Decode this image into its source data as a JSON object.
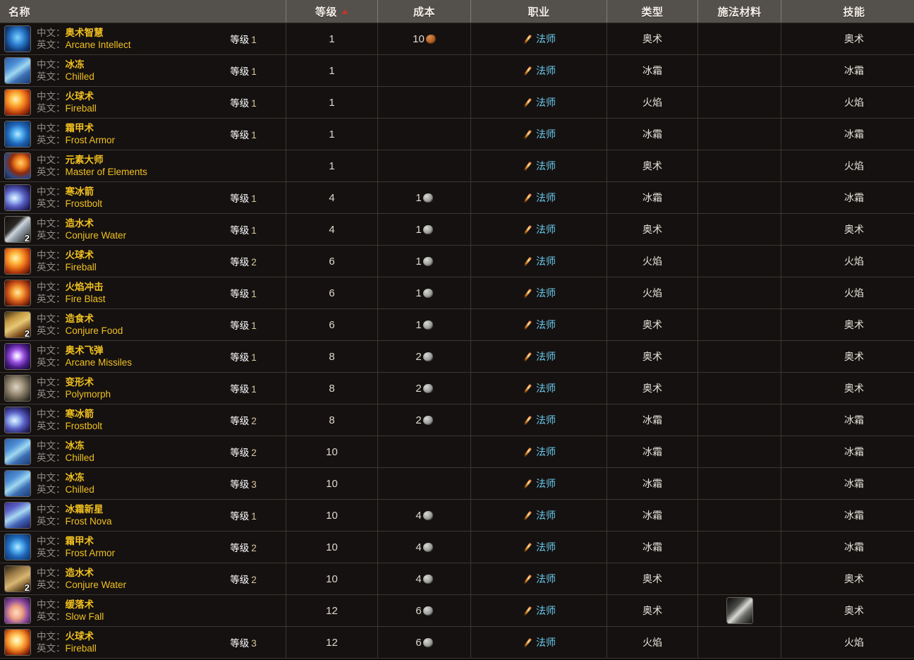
{
  "table": {
    "columns": [
      {
        "key": "name",
        "label": "名称",
        "sorted": false
      },
      {
        "key": "level",
        "label": "等级",
        "sorted": true,
        "sort_dir": "asc"
      },
      {
        "key": "cost",
        "label": "成本",
        "sorted": false
      },
      {
        "key": "class",
        "label": "职业",
        "sorted": false
      },
      {
        "key": "type",
        "label": "类型",
        "sorted": false
      },
      {
        "key": "reagent",
        "label": "施法材料",
        "sorted": false
      },
      {
        "key": "skill",
        "label": "技能",
        "sorted": false
      }
    ],
    "labels": {
      "cn": "中文：",
      "en": "英文：",
      "rank_prefix": "等级"
    },
    "colors": {
      "header_bg": "#54504b",
      "row_bg": "#151110",
      "spell_name": "#f0c020",
      "class_name": "#69ccf0",
      "sort_arrow": "#b3392f",
      "label_gray": "#8e8a84",
      "copper_coin": "#b5642c",
      "silver_coin": "#a3a3a0"
    },
    "rows": [
      {
        "icon": "arcane-intellect-icon",
        "icon_art": "arcane-intellect",
        "count": "",
        "cn": "奥术智慧",
        "en": "Arcane Intellect",
        "rank": "等级 1",
        "level": "1",
        "cost": "10",
        "coin": "copper",
        "class": "法师",
        "type": "奥术",
        "reagent": "",
        "skill": "奥术"
      },
      {
        "icon": "chilled-icon",
        "icon_art": "chilled",
        "count": "",
        "cn": "冰冻",
        "en": "Chilled",
        "rank": "等级 1",
        "level": "1",
        "cost": "",
        "coin": "",
        "class": "法师",
        "type": "冰霜",
        "reagent": "",
        "skill": "冰霜"
      },
      {
        "icon": "fireball-icon",
        "icon_art": "fireball",
        "count": "",
        "cn": "火球术",
        "en": "Fireball",
        "rank": "等级 1",
        "level": "1",
        "cost": "",
        "coin": "",
        "class": "法师",
        "type": "火焰",
        "reagent": "",
        "skill": "火焰"
      },
      {
        "icon": "frost-armor-icon",
        "icon_art": "frost-armor",
        "count": "",
        "cn": "霜甲术",
        "en": "Frost Armor",
        "rank": "等级 1",
        "level": "1",
        "cost": "",
        "coin": "",
        "class": "法师",
        "type": "冰霜",
        "reagent": "",
        "skill": "冰霜"
      },
      {
        "icon": "master-of-elements-icon",
        "icon_art": "master-elements",
        "count": "",
        "cn": "元素大师",
        "en": "Master of Elements",
        "rank": "",
        "level": "1",
        "cost": "",
        "coin": "",
        "class": "法师",
        "type": "奥术",
        "reagent": "",
        "skill": "火焰"
      },
      {
        "icon": "frostbolt-icon",
        "icon_art": "frostbolt",
        "count": "",
        "cn": "寒冰箭",
        "en": "Frostbolt",
        "rank": "等级 1",
        "level": "4",
        "cost": "1",
        "coin": "silver",
        "class": "法师",
        "type": "冰霜",
        "reagent": "",
        "skill": "冰霜"
      },
      {
        "icon": "conjure-water-icon",
        "icon_art": "conjure-water",
        "count": "2",
        "cn": "造水术",
        "en": "Conjure Water",
        "rank": "等级 1",
        "level": "4",
        "cost": "1",
        "coin": "silver",
        "class": "法师",
        "type": "奥术",
        "reagent": "",
        "skill": "奥术"
      },
      {
        "icon": "fireball-icon",
        "icon_art": "fireball",
        "count": "",
        "cn": "火球术",
        "en": "Fireball",
        "rank": "等级 2",
        "level": "6",
        "cost": "1",
        "coin": "silver",
        "class": "法师",
        "type": "火焰",
        "reagent": "",
        "skill": "火焰"
      },
      {
        "icon": "fire-blast-icon",
        "icon_art": "fire-blast",
        "count": "",
        "cn": "火焰冲击",
        "en": "Fire Blast",
        "rank": "等级 1",
        "level": "6",
        "cost": "1",
        "coin": "silver",
        "class": "法师",
        "type": "火焰",
        "reagent": "",
        "skill": "火焰"
      },
      {
        "icon": "conjure-food-icon",
        "icon_art": "conjure-food",
        "count": "2",
        "cn": "造食术",
        "en": "Conjure Food",
        "rank": "等级 1",
        "level": "6",
        "cost": "1",
        "coin": "silver",
        "class": "法师",
        "type": "奥术",
        "reagent": "",
        "skill": "奥术"
      },
      {
        "icon": "arcane-missiles-icon",
        "icon_art": "arcane-missiles",
        "count": "",
        "cn": "奥术飞弹",
        "en": "Arcane Missiles",
        "rank": "等级 1",
        "level": "8",
        "cost": "2",
        "coin": "silver",
        "class": "法师",
        "type": "奥术",
        "reagent": "",
        "skill": "奥术"
      },
      {
        "icon": "polymorph-icon",
        "icon_art": "polymorph",
        "count": "",
        "cn": "变形术",
        "en": "Polymorph",
        "rank": "等级 1",
        "level": "8",
        "cost": "2",
        "coin": "silver",
        "class": "法师",
        "type": "奥术",
        "reagent": "",
        "skill": "奥术"
      },
      {
        "icon": "frostbolt-icon",
        "icon_art": "frostbolt",
        "count": "",
        "cn": "寒冰箭",
        "en": "Frostbolt",
        "rank": "等级 2",
        "level": "8",
        "cost": "2",
        "coin": "silver",
        "class": "法师",
        "type": "冰霜",
        "reagent": "",
        "skill": "冰霜"
      },
      {
        "icon": "chilled-icon",
        "icon_art": "chilled",
        "count": "",
        "cn": "冰冻",
        "en": "Chilled",
        "rank": "等级 2",
        "level": "10",
        "cost": "",
        "coin": "",
        "class": "法师",
        "type": "冰霜",
        "reagent": "",
        "skill": "冰霜"
      },
      {
        "icon": "chilled-icon",
        "icon_art": "chilled",
        "count": "",
        "cn": "冰冻",
        "en": "Chilled",
        "rank": "等级 3",
        "level": "10",
        "cost": "",
        "coin": "",
        "class": "法师",
        "type": "冰霜",
        "reagent": "",
        "skill": "冰霜"
      },
      {
        "icon": "frost-nova-icon",
        "icon_art": "frost-nova",
        "count": "",
        "cn": "冰霜新星",
        "en": "Frost Nova",
        "rank": "等级 1",
        "level": "10",
        "cost": "4",
        "coin": "silver",
        "class": "法师",
        "type": "冰霜",
        "reagent": "",
        "skill": "冰霜"
      },
      {
        "icon": "frost-armor-icon",
        "icon_art": "frost-armor",
        "count": "",
        "cn": "霜甲术",
        "en": "Frost Armor",
        "rank": "等级 2",
        "level": "10",
        "cost": "4",
        "coin": "silver",
        "class": "法师",
        "type": "冰霜",
        "reagent": "",
        "skill": "冰霜"
      },
      {
        "icon": "conjure-water-icon",
        "icon_art": "conjure-water2",
        "count": "2",
        "cn": "造水术",
        "en": "Conjure Water",
        "rank": "等级 2",
        "level": "10",
        "cost": "4",
        "coin": "silver",
        "class": "法师",
        "type": "奥术",
        "reagent": "",
        "skill": "奥术"
      },
      {
        "icon": "slow-fall-icon",
        "icon_art": "slow-fall",
        "count": "",
        "cn": "缓落术",
        "en": "Slow Fall",
        "rank": "",
        "level": "12",
        "cost": "6",
        "coin": "silver",
        "class": "法师",
        "type": "奥术",
        "reagent": "light-feather-icon",
        "skill": "奥术"
      },
      {
        "icon": "fireball-icon",
        "icon_art": "fireball3",
        "count": "",
        "cn": "火球术",
        "en": "Fireball",
        "rank": "等级 3",
        "level": "12",
        "cost": "6",
        "coin": "silver",
        "class": "法师",
        "type": "火焰",
        "reagent": "",
        "skill": "火焰"
      }
    ]
  }
}
